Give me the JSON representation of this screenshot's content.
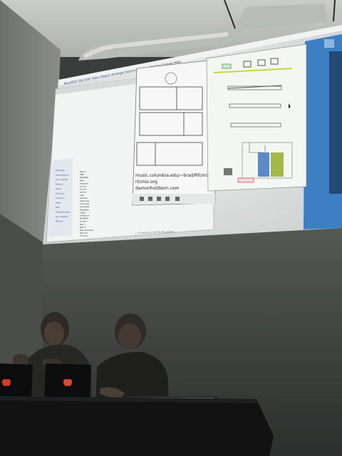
{
  "scene": {
    "description_free": true,
    "colors": {
      "wall_upper": "#cfd3cf",
      "wall_lower": "#3e423f",
      "projection": "#e4e7e6",
      "desktop_blue": "#3d7fc3",
      "table": "#121213",
      "laptop_logo": "#d23a2a"
    }
  },
  "menubar": {
    "items": [
      "MaxMSP",
      "File",
      "Edit",
      "View",
      "Object",
      "Arrange",
      "Options",
      "Debug",
      "Window",
      "Extras",
      "Help"
    ]
  },
  "patcher": {
    "caption_lines": [
      "music.columbia.edu/~brad/RTcmix",
      "rtcmix.org",
      "damonholzborn.com"
    ]
  },
  "finder": {
    "sidebar_items": [
      "Desktop",
      "Applications",
      "Documents",
      "Movies",
      "Music",
      "Pictures",
      "Dropbox",
      "Work",
      "Max",
      "Programming",
      "Documents",
      "RTcmix"
    ],
    "file_items": [
      "Max 5",
      "SMF",
      "MaxMSP",
      "EMC",
      "ireaderd",
      "rtcmix",
      "rtcmix~",
      "extras",
      "help",
      "patches",
      "externals",
      "max-help",
      "examples",
      "BuildMax",
      "utility",
      "reference",
      "MaxMSP",
      "rtcmix~",
      "Max",
      "Max 5",
      "Max-Libraries",
      "Mac OS",
      "rtcmix5"
    ],
    "status": "1 of 3 selected, 196.96 GB available"
  },
  "icons": [
    "apple-logo-icon",
    "apple-logo-icon"
  ]
}
